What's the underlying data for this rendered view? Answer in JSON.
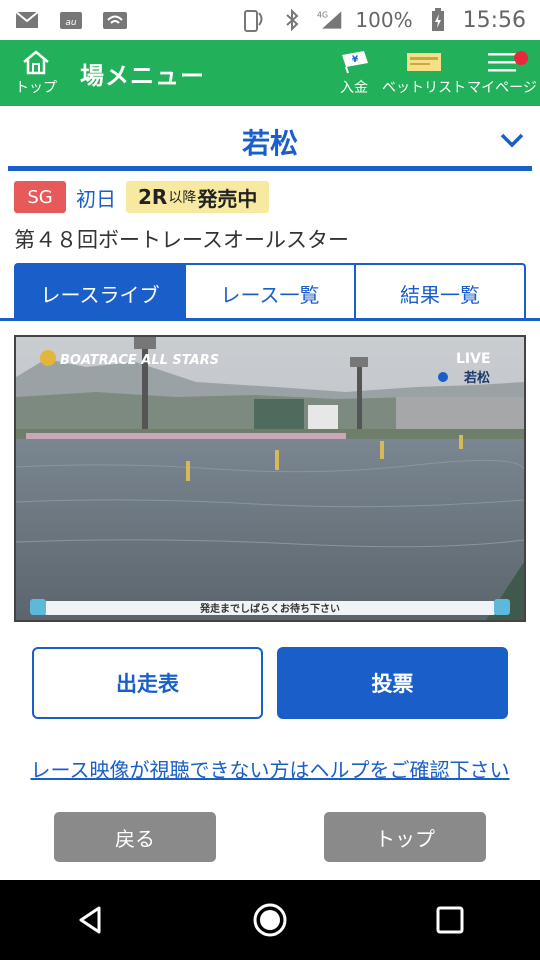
{
  "status_bar": {
    "battery": "100%",
    "time": "15:56",
    "network": "4G"
  },
  "header": {
    "home_label": "トップ",
    "title": "場メニュー",
    "deposit_label": "入金",
    "betlist_label": "ベットリスト",
    "mypage_label": "マイページ"
  },
  "venue": {
    "name": "若松"
  },
  "race": {
    "grade": "SG",
    "day": "初日",
    "sale_race": "2R",
    "sale_after": "以降",
    "sale_status": "発売中",
    "title": "第４８回ボートレースオールスター"
  },
  "tabs": [
    {
      "label": "レースライブ",
      "active": true
    },
    {
      "label": "レース一覧",
      "active": false
    },
    {
      "label": "結果一覧",
      "active": false
    }
  ],
  "video": {
    "event_logo": "BOATRACE ALL STARS",
    "live_label": "LIVE",
    "venue_logo": "若松",
    "caption": "発走までしばらくお待ち下さい"
  },
  "buttons": {
    "entry_table": "出走表",
    "vote": "投票"
  },
  "help_link": "レース映像が視聴できない方はヘルプをご確認下さい",
  "nav": {
    "back": "戻る",
    "top": "トップ"
  },
  "colors": {
    "header_green": "#22b15a",
    "accent_blue": "#1a5fc9",
    "sg_red": "#e85a5a",
    "sale_yellow": "#f8e9a0",
    "notification_red": "#e8283b"
  }
}
